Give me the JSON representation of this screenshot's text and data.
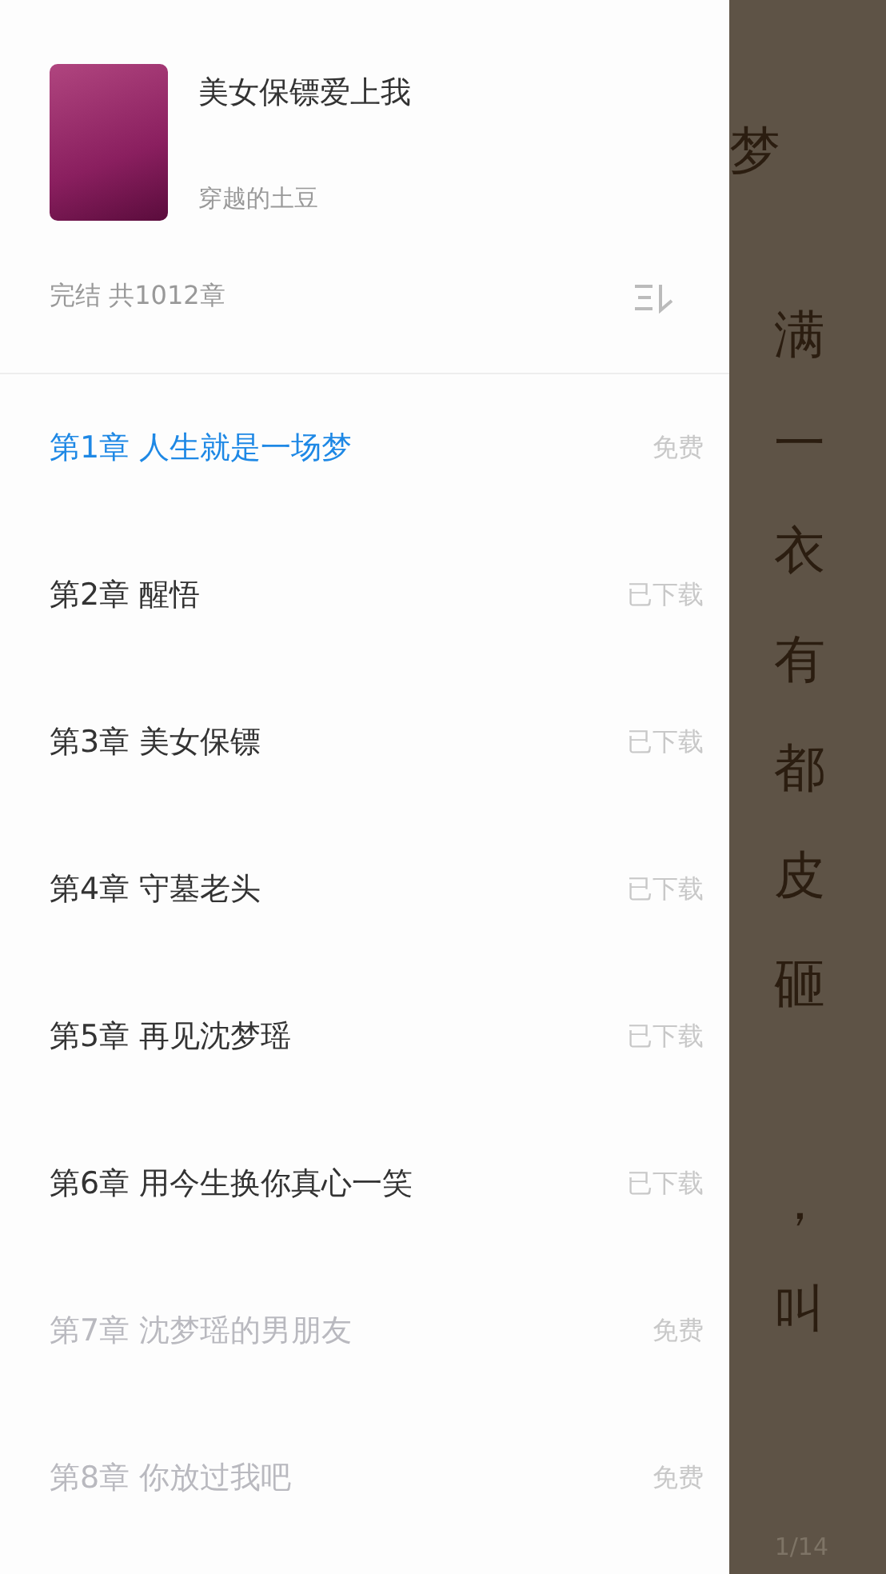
{
  "book": {
    "title": "美女保镖爱上我",
    "author": "穿越的土豆",
    "status": "完结 共1012章"
  },
  "chapters": [
    {
      "title": "第1章 人生就是一场梦",
      "badge": "免费",
      "selected": true,
      "dimmed": false
    },
    {
      "title": "第2章 醒悟",
      "badge": "已下载",
      "selected": false,
      "dimmed": false
    },
    {
      "title": "第3章 美女保镖",
      "badge": "已下载",
      "selected": false,
      "dimmed": false
    },
    {
      "title": "第4章 守墓老头",
      "badge": "已下载",
      "selected": false,
      "dimmed": false
    },
    {
      "title": "第5章 再见沈梦瑶",
      "badge": "已下载",
      "selected": false,
      "dimmed": false
    },
    {
      "title": "第6章 用今生换你真心一笑",
      "badge": "已下载",
      "selected": false,
      "dimmed": false
    },
    {
      "title": "第7章 沈梦瑶的男朋友",
      "badge": "免费",
      "selected": false,
      "dimmed": true
    },
    {
      "title": "第8章 你放过我吧",
      "badge": "免费",
      "selected": false,
      "dimmed": true
    }
  ],
  "reader": {
    "heading": "梦",
    "paragraphs": [
      [
        "满",
        "一",
        "衣",
        "有",
        "都",
        "皮",
        "砸"
      ],
      [
        "，",
        "叫"
      ]
    ],
    "page": "1/14"
  }
}
